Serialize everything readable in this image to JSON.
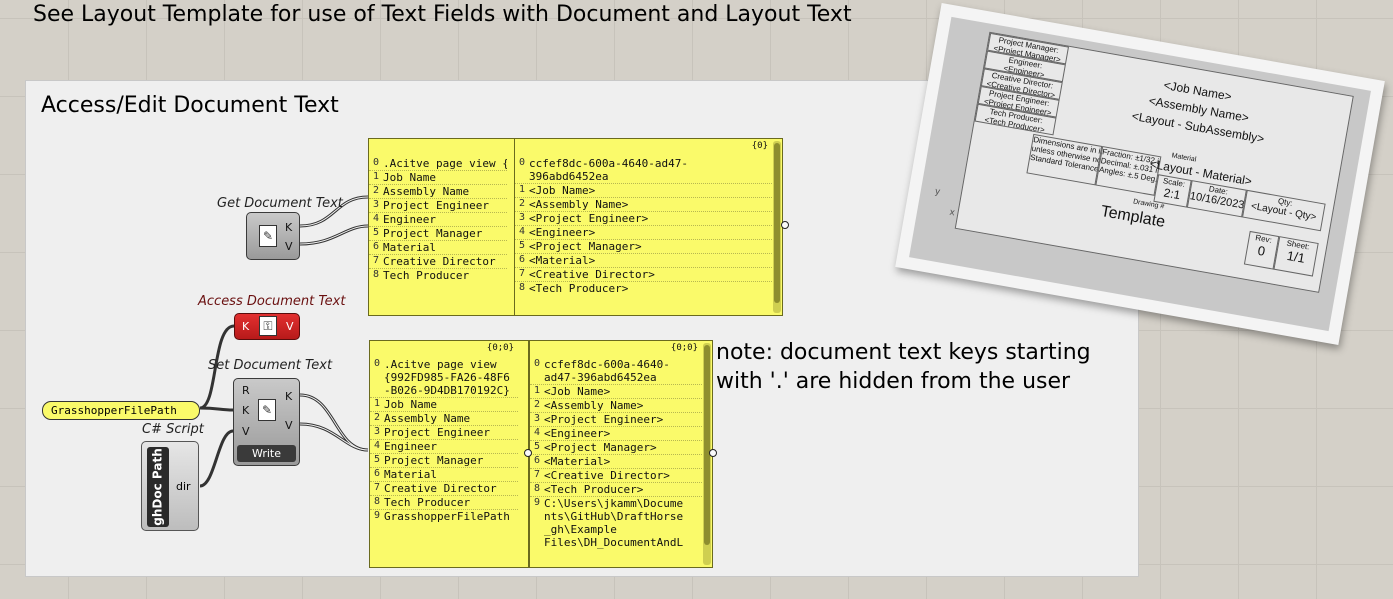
{
  "heading": "See Layout Template for use of Text Fields with Document and Layout Text",
  "group": {
    "title": "Access/Edit Document Text"
  },
  "labels": {
    "get_document_text": "Get Document Text",
    "access_document_text": "Access Document Text",
    "set_document_text": "Set Document Text",
    "csharp_script": "C# Script"
  },
  "components": {
    "get": {
      "out_k": "K",
      "out_v": "V"
    },
    "access": {
      "in_k": "K",
      "out_v": "V"
    },
    "set": {
      "in_r": "R",
      "in_k": "K",
      "in_v": "V",
      "out_k": "K",
      "out_v": "V",
      "write_button": "Write"
    },
    "csharp": {
      "name": "ghDoc Path",
      "out": "dir"
    }
  },
  "param": {
    "value": "GrasshopperFilePath"
  },
  "note": {
    "line1": "note: document text keys starting",
    "line2": "with '.' are hidden from the user"
  },
  "panels": {
    "keys_top": {
      "rows": [
        {
          "i": "0",
          "v": ".Acitve page view {"
        },
        {
          "i": "1",
          "v": "Job Name"
        },
        {
          "i": "2",
          "v": "Assembly Name"
        },
        {
          "i": "3",
          "v": "Project Engineer"
        },
        {
          "i": "4",
          "v": "Engineer"
        },
        {
          "i": "5",
          "v": "Project Manager"
        },
        {
          "i": "6",
          "v": "Material"
        },
        {
          "i": "7",
          "v": "Creative Director"
        },
        {
          "i": "8",
          "v": "Tech Producer"
        }
      ]
    },
    "values_top": {
      "tag": "{0}",
      "rows": [
        {
          "i": "0",
          "v": "ccfef8dc-600a-4640-ad47-\n396abd6452ea"
        },
        {
          "i": "1",
          "v": "<Job Name>"
        },
        {
          "i": "2",
          "v": "<Assembly Name>"
        },
        {
          "i": "3",
          "v": "<Project Engineer>"
        },
        {
          "i": "4",
          "v": "<Engineer>"
        },
        {
          "i": "5",
          "v": "<Project Manager>"
        },
        {
          "i": "6",
          "v": "<Material>"
        },
        {
          "i": "7",
          "v": "<Creative Director>"
        },
        {
          "i": "8",
          "v": "<Tech Producer>"
        }
      ]
    },
    "keys_bottom": {
      "tag": "{0;0}",
      "rows": [
        {
          "i": "0",
          "v": ".Acitve page view\n{992FD985-FA26-48F6\n-B026-9D4DB170192C}"
        },
        {
          "i": "1",
          "v": "Job Name"
        },
        {
          "i": "2",
          "v": "Assembly Name"
        },
        {
          "i": "3",
          "v": "Project Engineer"
        },
        {
          "i": "4",
          "v": "Engineer"
        },
        {
          "i": "5",
          "v": "Project Manager"
        },
        {
          "i": "6",
          "v": "Material"
        },
        {
          "i": "7",
          "v": "Creative Director"
        },
        {
          "i": "8",
          "v": "Tech Producer"
        },
        {
          "i": "9",
          "v": "GrasshopperFilePath"
        }
      ]
    },
    "values_bottom": {
      "tag": "{0;0}",
      "rows": [
        {
          "i": "0",
          "v": "ccfef8dc-600a-4640-\nad47-396abd6452ea"
        },
        {
          "i": "1",
          "v": "<Job Name>"
        },
        {
          "i": "2",
          "v": "<Assembly Name>"
        },
        {
          "i": "3",
          "v": "<Project Engineer>"
        },
        {
          "i": "4",
          "v": "<Engineer>"
        },
        {
          "i": "5",
          "v": "<Project Manager>"
        },
        {
          "i": "6",
          "v": "<Material>"
        },
        {
          "i": "7",
          "v": "<Creative Director>"
        },
        {
          "i": "8",
          "v": "<Tech Producer>"
        },
        {
          "i": "9",
          "v": "C:\\Users\\jkamm\\Docume\nnts\\GitHub\\DraftHorse\n_gh\\Example\nFiles\\DH_DocumentAndL"
        }
      ]
    }
  },
  "title_block": {
    "project_manager_label": "Project Manager:",
    "project_manager": "<Project Manager>",
    "engineer_label": "Engineer:",
    "engineer": "<Engineer>",
    "creative_director_label": "Creative Director:",
    "creative_director": "<Creative Director>",
    "project_engineer_label": "Project Engineer:",
    "project_engineer": "<Project Engineer>",
    "tech_producer_label": "Tech Producer:",
    "tech_producer": "<Tech Producer>",
    "job_name": "<Job Name>",
    "assembly_name": "<Assembly Name>",
    "layout_sub": "<Layout - SubAssembly>",
    "material_label": "Material",
    "material": "<Layout - Material>",
    "dims_note": "Dimensions are in inches\nunless otherwise noted\nStandard Tolerances",
    "tolerances": "Fraction: ±1/32 in.\nDecimal: ±.031 in.\nAngles: ±.5 Deg.",
    "scale_label": "Scale:",
    "scale": "2:1",
    "date_label": "Date:",
    "date": "10/16/2023",
    "qty_label": "Qty:",
    "qty": "<Layout - Qty>",
    "drawing_label": "Drawing #",
    "drawing": "Template",
    "rev_label": "Rev:",
    "rev": "0",
    "sheet_label": "Sheet:",
    "sheet": "1/1",
    "axis_y": "y",
    "axis_x": "x"
  }
}
